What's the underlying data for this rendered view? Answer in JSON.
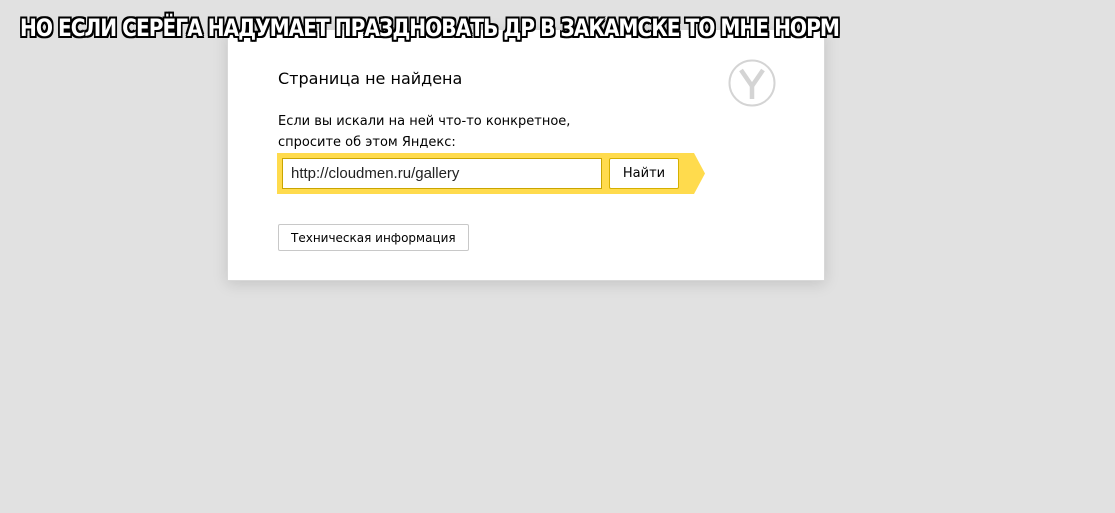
{
  "meme": {
    "caption": "НО ЕСЛИ СЕРЁГА НАДУМАЕТ ПРАЗДНОВАТЬ ДР В ЗАКАМСКЕ ТО МНЕ НОРМ"
  },
  "error_page": {
    "title": "Страница не найдена",
    "description_line1": "Если вы искали на ней что-то конкретное,",
    "description_line2": "спросите об этом Яндекс:",
    "logo_icon": "yandex-logo-icon",
    "search": {
      "value": "http://cloudmen.ru/gallery",
      "button_label": "Найти",
      "accent_color": "#ffdb4d"
    },
    "tech_info_label": "Техническая информация"
  },
  "colors": {
    "background": "#e1e1e1",
    "card": "#ffffff",
    "accent": "#ffdb4d"
  }
}
